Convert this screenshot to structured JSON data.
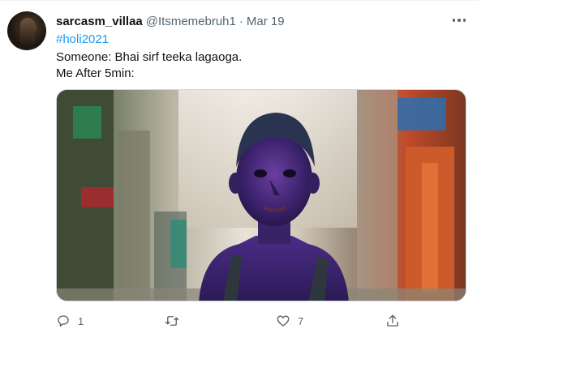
{
  "tweet": {
    "display_name": "sarcasm_villaa",
    "handle": "@Itsmemebruh1",
    "separator": "·",
    "date": "Mar 19",
    "hashtag": "#holi2021",
    "line1": "Someone: Bhai sirf teeka lagaoga.",
    "line2": "Me After 5min:"
  },
  "actions": {
    "reply_count": "1",
    "like_count": "7"
  },
  "icons": {
    "more": "more-icon",
    "reply": "reply-icon",
    "retweet": "retweet-icon",
    "like": "like-icon",
    "share": "share-icon"
  },
  "colors": {
    "link": "#1d9bf0",
    "secondary_text": "#536471",
    "primary_text": "#0f1419"
  }
}
